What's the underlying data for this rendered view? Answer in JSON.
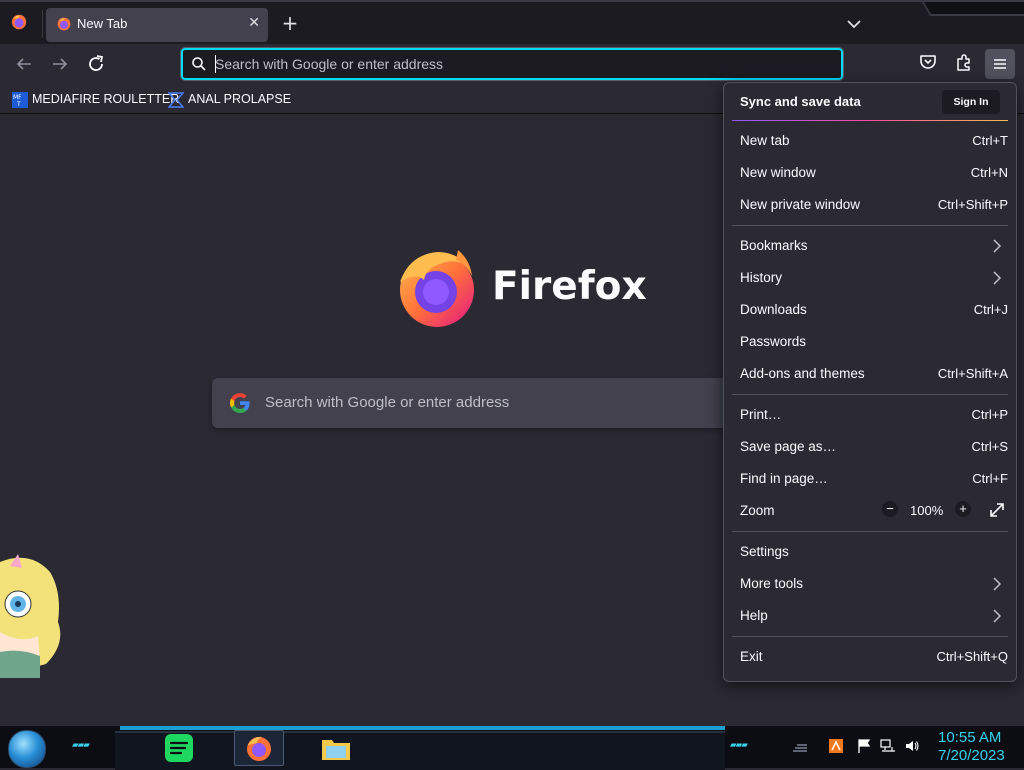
{
  "browser": {
    "tab_title": "New Tab",
    "url_placeholder": "Search with Google or enter address"
  },
  "bookmarks": [
    {
      "label": "MEDIAFIRE ROULETTER",
      "icon": "mediafire-icon"
    },
    {
      "label": "ANAL PROLAPSE",
      "icon": "bookmark-site-icon"
    }
  ],
  "content": {
    "wordmark": "Firefox",
    "search_placeholder": "Search with Google or enter address"
  },
  "appmenu": {
    "sync_title": "Sync and save data",
    "sign_in": "Sign In",
    "items": [
      {
        "label": "New tab",
        "shortcut": "Ctrl+T"
      },
      {
        "label": "New window",
        "shortcut": "Ctrl+N"
      },
      {
        "label": "New private window",
        "shortcut": "Ctrl+Shift+P"
      },
      {
        "label": "Bookmarks",
        "shortcut": ""
      },
      {
        "label": "History",
        "shortcut": ""
      },
      {
        "label": "Downloads",
        "shortcut": "Ctrl+J"
      },
      {
        "label": "Passwords",
        "shortcut": ""
      },
      {
        "label": "Add-ons and themes",
        "shortcut": "Ctrl+Shift+A"
      },
      {
        "label": "Print…",
        "shortcut": "Ctrl+P"
      },
      {
        "label": "Save page as…",
        "shortcut": "Ctrl+S"
      },
      {
        "label": "Find in page…",
        "shortcut": "Ctrl+F"
      },
      {
        "label": "Zoom",
        "shortcut": ""
      },
      {
        "label": "Settings",
        "shortcut": ""
      },
      {
        "label": "More tools",
        "shortcut": ""
      },
      {
        "label": "Help",
        "shortcut": ""
      },
      {
        "label": "Exit",
        "shortcut": "Ctrl+Shift+Q"
      }
    ],
    "zoom": {
      "minus": "−",
      "value": "100%",
      "plus": "+"
    }
  },
  "taskbar": {
    "time": "10:55 AM",
    "date": "7/20/2023"
  },
  "colors": {
    "accent_focus": "#00ddff",
    "toolbar": "#2b2a33",
    "tabstrip": "#1c1b22",
    "taskbar_cyan": "#39d0ec"
  }
}
